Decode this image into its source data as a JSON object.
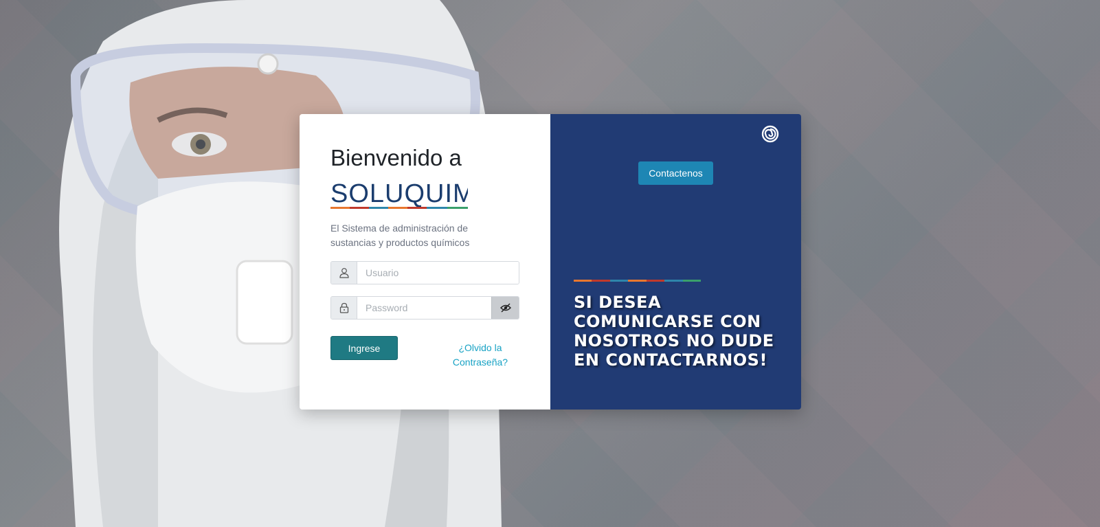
{
  "login": {
    "welcome_title": "Bienvenido a",
    "brand_name": "SOLUQUIM",
    "subtitle": "El Sistema de administración de sustancias y productos químicos",
    "username_placeholder": "Usuario",
    "password_placeholder": "Password",
    "login_button": "Ingrese",
    "forgot_password": "¿Olvido la Contraseña?"
  },
  "promo": {
    "contact_button": "Contactenos",
    "message": "SI DESEA COMUNICARSE CON NOSOTROS NO DUDE EN CONTACTARNOS!"
  },
  "colors": {
    "panel_right_bg": "#213b74",
    "login_button": "#1f7a83",
    "contact_button": "#1e86b4",
    "link": "#17a2c4",
    "brand_stripe": [
      "#e8772e",
      "#c0392b",
      "#2e86ab",
      "#e8772e",
      "#c0392b",
      "#2e86ab",
      "#3aa06b"
    ]
  },
  "icons": {
    "user_addon": "user-icon",
    "password_addon": "lock-icon",
    "password_toggle": "eye-slash-icon",
    "brand_mark": "spiral-logo-icon"
  }
}
